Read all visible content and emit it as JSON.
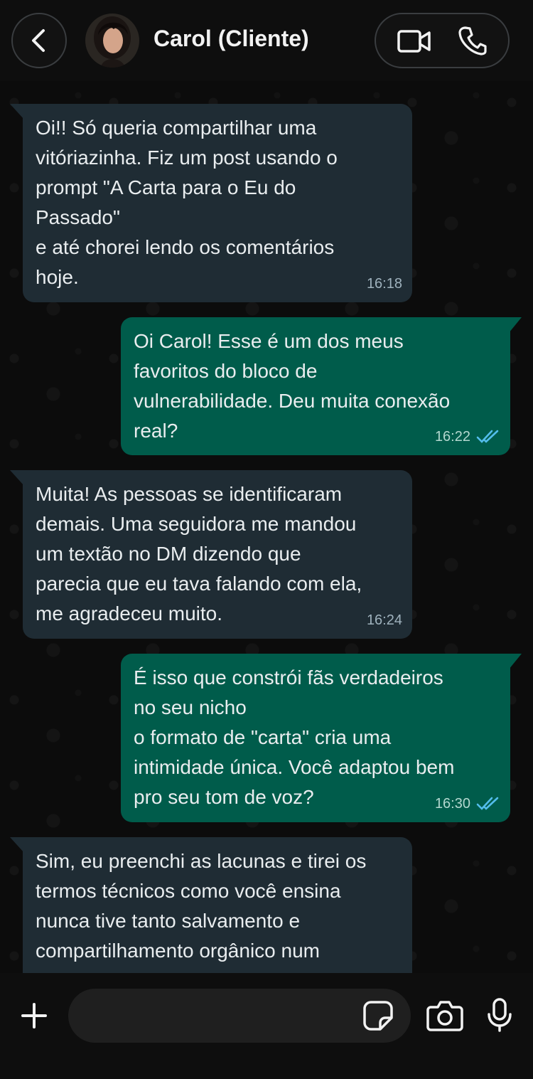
{
  "header": {
    "contact_name": "Carol (Cliente)",
    "icons": [
      "back-arrow-icon",
      "avatar",
      "video-camera-icon",
      "phone-icon"
    ]
  },
  "messages": [
    {
      "direction": "in",
      "text": "Oi!! Só queria compartilhar uma\nvitóriazinha. Fiz um post usando o\nprompt \"A Carta para o Eu do\nPassado\"\ne até chorei lendo os comentários\nhoje.",
      "time": "16:18"
    },
    {
      "direction": "out",
      "text": "Oi Carol! Esse é um dos meus\nfavoritos do bloco de\nvulnerabilidade. Deu muita conexão\nreal?",
      "time": "16:22",
      "status": "read"
    },
    {
      "direction": "in",
      "text": "Muita! As pessoas se identificaram\ndemais. Uma seguidora me mandou\num textão no DM dizendo que\nparecia que eu tava falando com ela,\nme agradeceu muito.",
      "time": "16:24"
    },
    {
      "direction": "out",
      "text": "É isso que constrói fãs verdadeiros\nno seu nicho\no formato de \"carta\" cria uma\nintimidade única. Você adaptou bem\npro seu tom de voz?",
      "time": "16:30",
      "status": "read"
    },
    {
      "direction": "in",
      "text": "Sim, eu preenchi as lacunas e tirei os\ntermos técnicos como você ensina\nnunca tive tanto salvamento e\ncompartilhamento orgânico num\npost. Muito obrigada.",
      "time": ""
    }
  ],
  "composer": {
    "placeholder": "",
    "icons": [
      "plus-icon",
      "sticker-icon",
      "camera-icon",
      "microphone-icon"
    ]
  },
  "colors": {
    "incoming_bubble": "#1f2c34",
    "outgoing_bubble": "#005c4b",
    "read_ticks": "#53bdeb"
  }
}
